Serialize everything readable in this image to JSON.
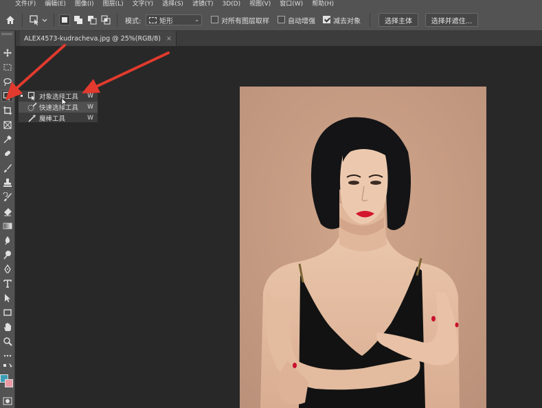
{
  "menubar": {
    "items": [
      "文件(F)",
      "编辑(E)",
      "图像(I)",
      "图层(L)",
      "文字(Y)",
      "选择(S)",
      "滤镜(T)",
      "3D(D)",
      "视图(V)",
      "窗口(W)",
      "帮助(H)"
    ]
  },
  "options": {
    "mode_label": "模式:",
    "mode_value": "矩形",
    "sample_all_layers_label": "对所有图层取样",
    "sample_all_layers_checked": false,
    "auto_enhance_label": "自动增强",
    "auto_enhance_checked": false,
    "subtract_object_label": "减去对象",
    "subtract_object_checked": true,
    "select_subject_button": "选择主体",
    "select_and_mask_button": "选择并遮住..."
  },
  "document": {
    "tab_title": "ALEX4573-kudracheva.jpg @ 25%(RGB/8)",
    "close_glyph": "×",
    "canvas_bg": "#282828",
    "photo_bg": "#c59a7f"
  },
  "flyout": {
    "items": [
      {
        "label": "对象选择工具",
        "shortcut": "W",
        "icon": "object-selection-icon",
        "active": true
      },
      {
        "label": "快速选择工具",
        "shortcut": "W",
        "icon": "quick-selection-icon",
        "active": false
      },
      {
        "label": "魔棒工具",
        "shortcut": "W",
        "icon": "magic-wand-icon",
        "active": false
      }
    ]
  },
  "toolbar": {
    "tools": [
      "move-tool-icon",
      "marquee-tool-icon",
      "lasso-tool-icon",
      "object-selection-tool-icon",
      "crop-tool-icon",
      "frame-tool-icon",
      "eyedropper-tool-icon",
      "healing-brush-icon",
      "brush-tool-icon",
      "clone-stamp-icon",
      "history-brush-icon",
      "eraser-tool-icon",
      "gradient-tool-icon",
      "blur-tool-icon",
      "dodge-tool-icon",
      "pen-tool-icon",
      "type-tool-icon",
      "path-selection-icon",
      "rectangle-tool-icon",
      "hand-tool-icon",
      "zoom-tool-icon",
      "more-tools-icon"
    ],
    "foreground_color": "#3aa0b5",
    "background_color": "#e99aa4"
  },
  "annotation_color": "#e23a2e"
}
